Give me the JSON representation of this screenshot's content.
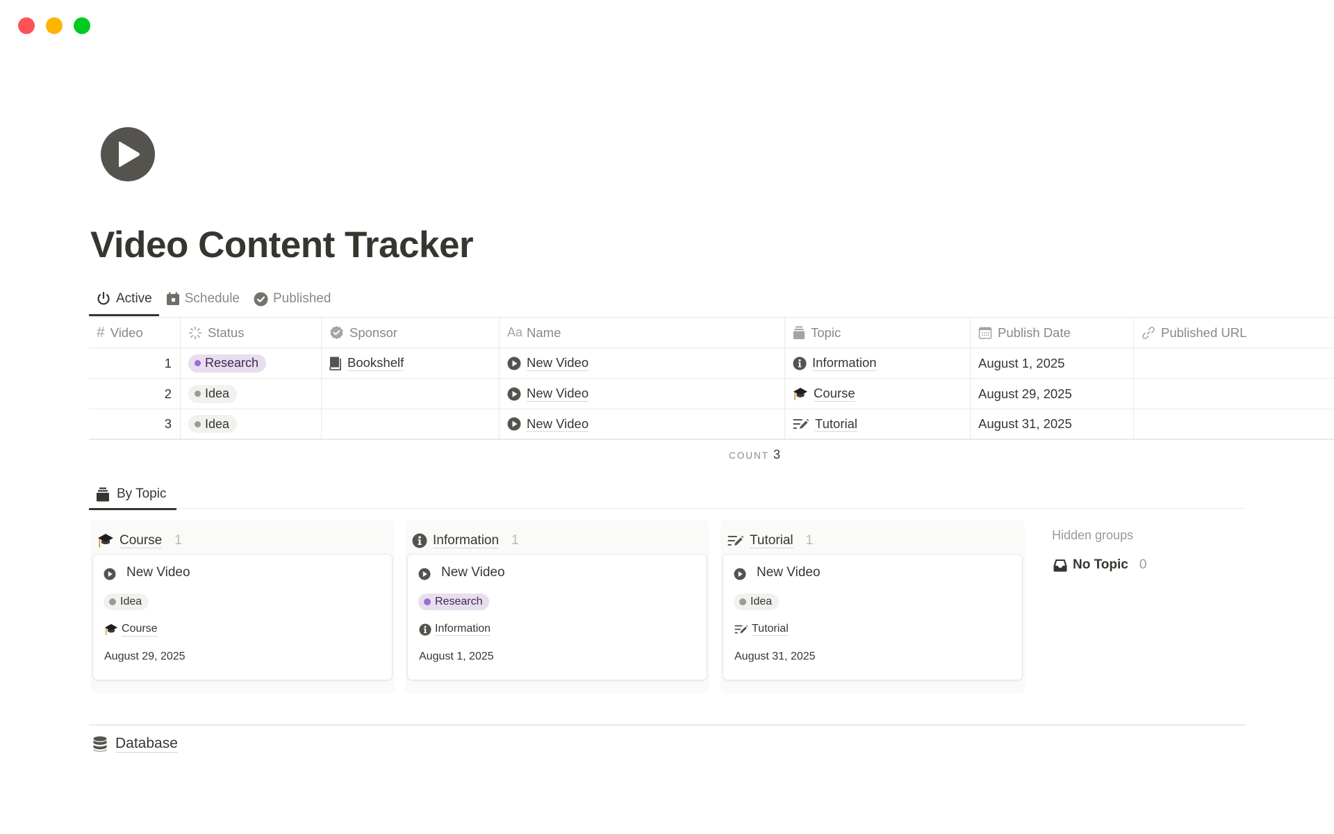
{
  "window": {
    "controls": [
      "close",
      "minimize",
      "zoom"
    ]
  },
  "page": {
    "icon": "play-circle-icon",
    "title": "Video Content Tracker"
  },
  "views": {
    "tabs": [
      {
        "label": "Active",
        "icon": "power-icon",
        "active": true
      },
      {
        "label": "Schedule",
        "icon": "calendar-icon",
        "active": false
      },
      {
        "label": "Published",
        "icon": "check-circle-icon",
        "active": false
      }
    ]
  },
  "table": {
    "columns": [
      {
        "label": "Video",
        "icon": "hash-icon"
      },
      {
        "label": "Status",
        "icon": "status-spinner-icon"
      },
      {
        "label": "Sponsor",
        "icon": "badge-check-icon"
      },
      {
        "label": "Name",
        "icon": "text-aa-icon"
      },
      {
        "label": "Topic",
        "icon": "stack-icon"
      },
      {
        "label": "Publish Date",
        "icon": "calendar-icon"
      },
      {
        "label": "Published URL",
        "icon": "link-icon"
      }
    ],
    "rows": [
      {
        "video": "1",
        "status": "Research",
        "status_color": "#9a6dd7",
        "sponsor": "Bookshelf",
        "sponsor_icon": "book-icon",
        "name": "New Video",
        "topic": "Information",
        "topic_icon": "info-circle-icon",
        "publish_date": "August 1, 2025",
        "published_url": ""
      },
      {
        "video": "2",
        "status": "Idea",
        "status_color": "#9b9a97",
        "sponsor": "",
        "name": "New Video",
        "topic": "Course",
        "topic_icon": "graduation-cap-icon",
        "publish_date": "August 29, 2025",
        "published_url": ""
      },
      {
        "video": "3",
        "status": "Idea",
        "status_color": "#9b9a97",
        "sponsor": "",
        "name": "New Video",
        "topic": "Tutorial",
        "topic_icon": "edit-lines-icon",
        "publish_date": "August 31, 2025",
        "published_url": ""
      }
    ],
    "footer": {
      "count_label": "COUNT",
      "count_value": "3"
    }
  },
  "board": {
    "tab": {
      "label": "By Topic",
      "icon": "stack-icon"
    },
    "groups": [
      {
        "label": "Course",
        "icon": "graduation-cap-icon",
        "count": "1",
        "cards": [
          {
            "title": "New Video",
            "status": "Idea",
            "topic": "Course",
            "date": "August 29, 2025"
          }
        ]
      },
      {
        "label": "Information",
        "icon": "info-circle-icon",
        "count": "1",
        "cards": [
          {
            "title": "New Video",
            "status": "Research",
            "topic": "Information",
            "date": "August 1, 2025"
          }
        ]
      },
      {
        "label": "Tutorial",
        "icon": "edit-lines-icon",
        "count": "1",
        "cards": [
          {
            "title": "New Video",
            "status": "Idea",
            "topic": "Tutorial",
            "date": "August 31, 2025"
          }
        ]
      }
    ],
    "hidden_groups_label": "Hidden groups",
    "hidden_groups": [
      {
        "label": "No Topic",
        "icon": "inbox-icon",
        "count": "0"
      }
    ]
  },
  "footer_link": {
    "label": "Database",
    "icon": "database-icon"
  },
  "colors": {
    "text": "#37352f",
    "muted": "#8a8883",
    "border": "#e9e9e7",
    "research_bg": "#e8deee",
    "research_text": "#412454",
    "research_dot": "#9a6dd7",
    "idea_bg": "#f1f1ef",
    "idea_dot": "#9b9a97",
    "close": "#ff5257",
    "minimize": "#ffb301",
    "zoom": "#00ca22"
  }
}
